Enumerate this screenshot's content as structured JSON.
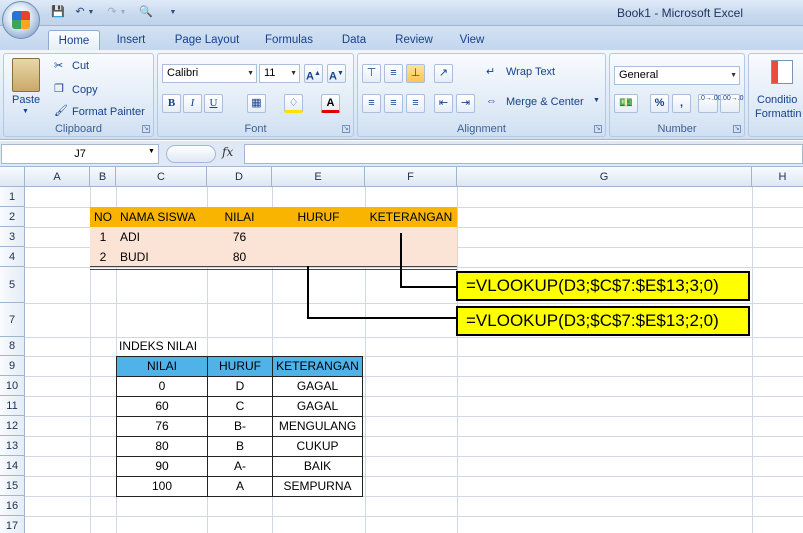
{
  "window": {
    "title": "Book1 - Microsoft Excel"
  },
  "tabs": [
    {
      "label": "Home"
    },
    {
      "label": "Insert"
    },
    {
      "label": "Page Layout"
    },
    {
      "label": "Formulas"
    },
    {
      "label": "Data"
    },
    {
      "label": "Review"
    },
    {
      "label": "View"
    }
  ],
  "ribbon": {
    "clipboard": {
      "paste": "Paste",
      "cut": "Cut",
      "copy": "Copy",
      "format_painter": "Format Painter",
      "label": "Clipboard"
    },
    "font": {
      "name": "Calibri",
      "size": "11",
      "bold": "B",
      "italic": "I",
      "underline": "U",
      "label": "Font"
    },
    "alignment": {
      "wrap_text": "Wrap Text",
      "merge_center": "Merge & Center",
      "label": "Alignment"
    },
    "number": {
      "format": "General",
      "percent": "%",
      "comma": ",",
      "inc_decimal": ".0→.00",
      "dec_decimal": ".00→.0",
      "label": "Number"
    },
    "styles": {
      "conditional_line1": "Conditio",
      "conditional_line2": "Formattin"
    }
  },
  "formula_bar": {
    "name_box": "J7",
    "fx": "fx",
    "value": ""
  },
  "columns": [
    "A",
    "B",
    "C",
    "D",
    "E",
    "F",
    "G",
    "H"
  ],
  "rows": [
    "1",
    "2",
    "3",
    "4",
    "5",
    "7",
    "8",
    "9",
    "10",
    "11",
    "12",
    "13",
    "14",
    "15",
    "16",
    "17"
  ],
  "student_table": {
    "headers": [
      "NO",
      "NAMA SISWA",
      "NILAI",
      "HURUF",
      "KETERANGAN"
    ],
    "rows": [
      [
        "1",
        "ADI",
        "76"
      ],
      [
        "2",
        "BUDI",
        "80"
      ]
    ]
  },
  "formulas": [
    "=VLOOKUP(D3;$C$7:$E$13;3;0)",
    "=VLOOKUP(D3;$C$7:$E$13;2;0)"
  ],
  "index_table": {
    "title": "INDEKS NILAI",
    "headers": [
      "NILAI",
      "HURUF",
      "KETERANGAN"
    ],
    "rows": [
      [
        "0",
        "D",
        "GAGAL"
      ],
      [
        "60",
        "C",
        "GAGAL"
      ],
      [
        "76",
        "B-",
        "MENGULANG"
      ],
      [
        "80",
        "B",
        "CUKUP"
      ],
      [
        "90",
        "A-",
        "BAIK"
      ],
      [
        "100",
        "A",
        "SEMPURNA"
      ]
    ]
  },
  "colors": {
    "header_orange": "#f9b401",
    "peach": "#fbe4d5",
    "index_header_blue": "#4fb2e8",
    "formula_box": "#ffff00"
  }
}
